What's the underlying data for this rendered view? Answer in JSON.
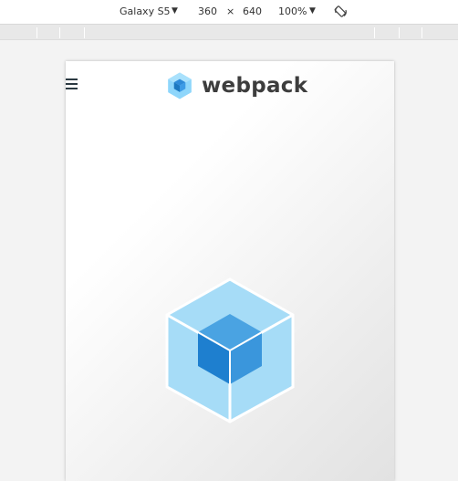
{
  "toolbar": {
    "device": "Galaxy S5",
    "width": "360",
    "separator": "×",
    "height": "640",
    "zoom": "100%"
  },
  "site": {
    "brand": "webpack"
  },
  "colors": {
    "cube_light": "#8ed6fb",
    "cube_dark": "#1c78c0",
    "cube_outline": "#ffffff",
    "text_dark": "#3d3d3d"
  },
  "icons": {
    "rotate": "rotate-icon",
    "menu": "hamburger-menu-icon",
    "logo": "webpack-cube-icon"
  }
}
